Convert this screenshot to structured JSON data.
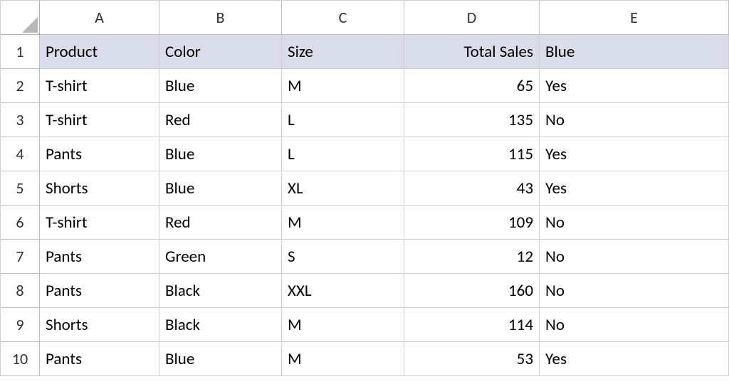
{
  "columns": [
    "A",
    "B",
    "C",
    "D",
    "E"
  ],
  "row_numbers": [
    1,
    2,
    3,
    4,
    5,
    6,
    7,
    8,
    9,
    10
  ],
  "headers": {
    "A": "Product",
    "B": "Color",
    "C": "Size",
    "D": "Total Sales",
    "E": "Blue"
  },
  "rows": [
    {
      "A": "T-shirt",
      "B": "Blue",
      "C": "M",
      "D": 65,
      "E": "Yes"
    },
    {
      "A": "T-shirt",
      "B": "Red",
      "C": "L",
      "D": 135,
      "E": "No"
    },
    {
      "A": "Pants",
      "B": "Blue",
      "C": "L",
      "D": 115,
      "E": "Yes"
    },
    {
      "A": "Shorts",
      "B": "Blue",
      "C": "XL",
      "D": 43,
      "E": "Yes"
    },
    {
      "A": "T-shirt",
      "B": "Red",
      "C": "M",
      "D": 109,
      "E": "No"
    },
    {
      "A": "Pants",
      "B": "Green",
      "C": "S",
      "D": 12,
      "E": "No"
    },
    {
      "A": "Pants",
      "B": "Black",
      "C": "XXL",
      "D": 160,
      "E": "No"
    },
    {
      "A": "Shorts",
      "B": "Black",
      "C": "M",
      "D": 114,
      "E": "No"
    },
    {
      "A": "Pants",
      "B": "Blue",
      "C": "M",
      "D": 53,
      "E": "Yes"
    }
  ],
  "chart_data": {
    "type": "table",
    "title": "",
    "columns": [
      "Product",
      "Color",
      "Size",
      "Total Sales",
      "Blue"
    ],
    "data": [
      [
        "T-shirt",
        "Blue",
        "M",
        65,
        "Yes"
      ],
      [
        "T-shirt",
        "Red",
        "L",
        135,
        "No"
      ],
      [
        "Pants",
        "Blue",
        "L",
        115,
        "Yes"
      ],
      [
        "Shorts",
        "Blue",
        "XL",
        43,
        "Yes"
      ],
      [
        "T-shirt",
        "Red",
        "M",
        109,
        "No"
      ],
      [
        "Pants",
        "Green",
        "S",
        12,
        "No"
      ],
      [
        "Pants",
        "Black",
        "XXL",
        160,
        "No"
      ],
      [
        "Shorts",
        "Black",
        "M",
        114,
        "No"
      ],
      [
        "Pants",
        "Blue",
        "M",
        53,
        "Yes"
      ]
    ]
  }
}
